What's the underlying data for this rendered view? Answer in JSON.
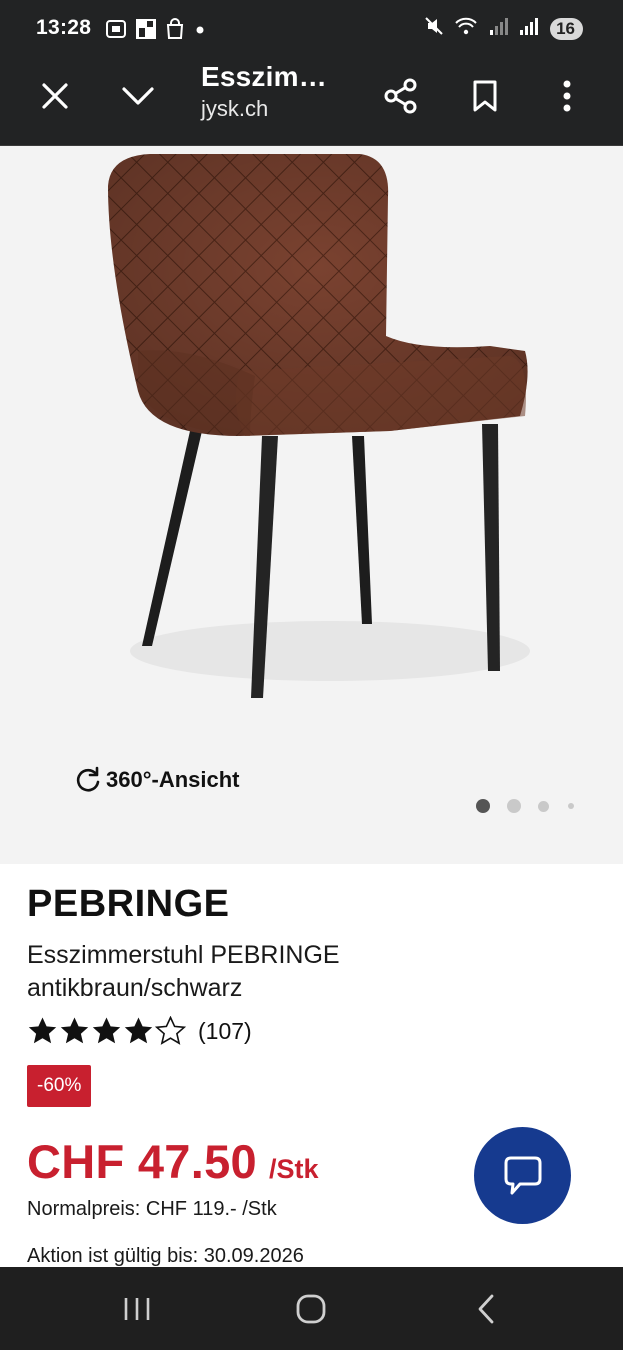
{
  "status_bar": {
    "time": "13:28",
    "battery": "16",
    "icons": [
      "screenshot-icon",
      "gallery-icon",
      "shopping-bag-icon",
      "notification-dot-icon",
      "mute-icon",
      "wifi-icon",
      "signal-icon",
      "signal-roaming-icon",
      "battery-icon"
    ]
  },
  "app_bar": {
    "title": "Esszim…",
    "domain": "jysk.ch"
  },
  "hero": {
    "view360_label": "360°-Ansicht",
    "carousel_count": 4,
    "carousel_active": 0
  },
  "product": {
    "brand": "PEBRINGE",
    "subtitle": "Esszimmerstuhl PEBRINGE antikbraun/schwarz",
    "rating": 4,
    "rating_max": 5,
    "rating_count": "(107)",
    "discount": "-60%",
    "price": "CHF 47.50",
    "price_unit": "/Stk",
    "normal_price": "Normalpreis: CHF 119.- /Stk",
    "valid_until": "Aktion ist gültig bis: 30.09.2026"
  },
  "colors": {
    "accent_red": "#c8202f",
    "chat_blue": "#163a8f",
    "bar_dark": "#222324"
  }
}
